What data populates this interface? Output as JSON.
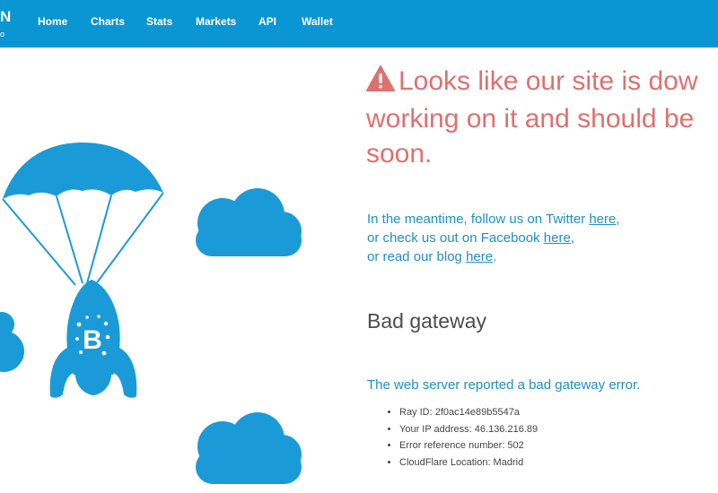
{
  "nav": {
    "logo_text": "N",
    "logo_sub": "o",
    "items": [
      {
        "label": "Home"
      },
      {
        "label": "Charts"
      },
      {
        "label": "Stats"
      },
      {
        "label": "Markets"
      },
      {
        "label": "API"
      },
      {
        "label": "Wallet"
      }
    ]
  },
  "main": {
    "headline_line1": "Looks like our site is dow",
    "headline_line2": "working on it and should be",
    "headline_line3": "soon.",
    "meantime_1": "In the meantime, follow us on Twitter ",
    "meantime_2": "or check us out on Facebook ",
    "meantime_3": "or read our blog ",
    "link_label": "here",
    "comma": ",",
    "period": ".",
    "error_title": "Bad gateway",
    "error_description": "The web server reported a bad gateway error.",
    "details": [
      "Ray ID: 2f0ac14e89b5547a",
      "Your IP address: 46.136.216.89",
      "Error reference number: 502",
      "CloudFlare Location: Madrid"
    ]
  },
  "colors": {
    "brand_blue": "#0a95d3",
    "warning_red": "#e0706f",
    "link_blue": "#1e8fc7"
  },
  "icons": [
    "warning-icon",
    "parachute-rocket-illustration",
    "cloud-illustration",
    "bitcoin-logo"
  ]
}
